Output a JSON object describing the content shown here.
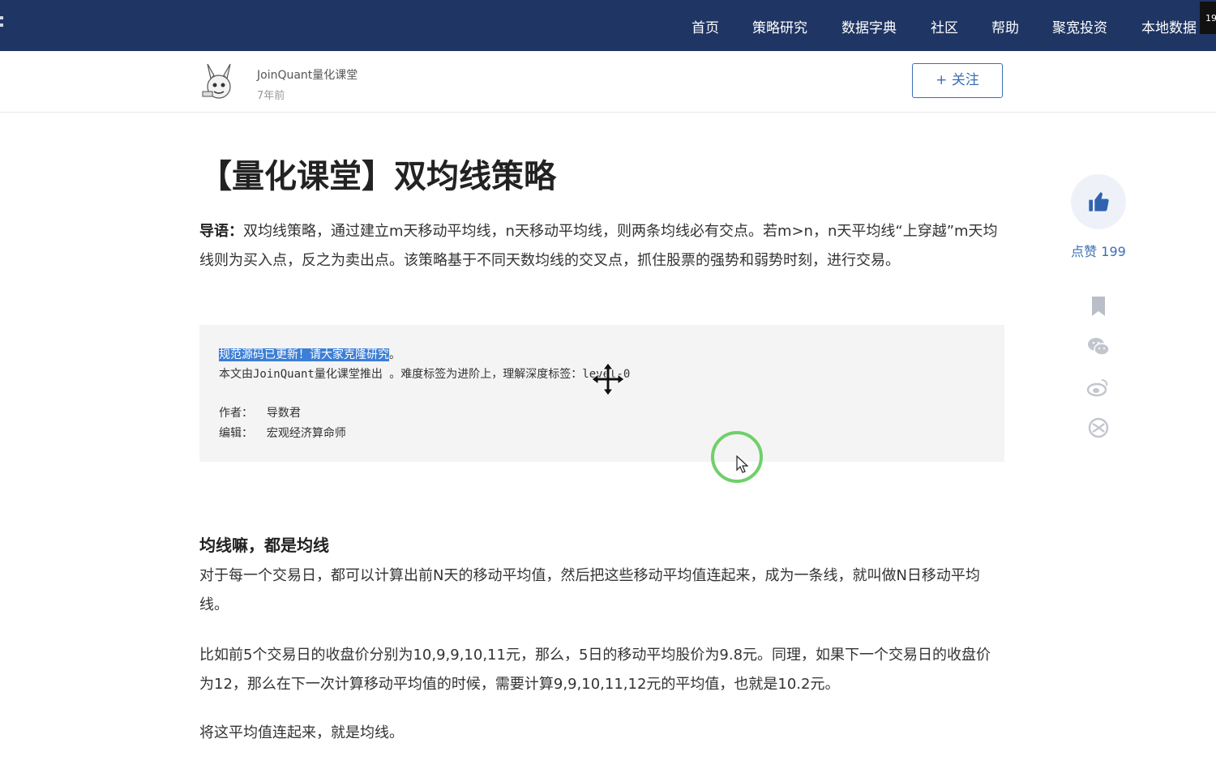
{
  "nav": {
    "items": [
      "首页",
      "策略研究",
      "数据字典",
      "社区",
      "帮助",
      "聚宽投资",
      "本地数据"
    ],
    "badge": "19"
  },
  "author": {
    "name": "JoinQuant量化课堂",
    "time": "7年前",
    "follow_label": "+ 关注"
  },
  "article": {
    "title": "【量化课堂】双均线策略",
    "intro_label": "导语：",
    "intro_text": "双均线策略，通过建立m天移动平均线，n天移动平均线，则两条均线必有交点。若m>n，n天平均线“上穿越”m天均线则为买入点，反之为卖出点。该策略基于不同天数均线的交叉点，抓住股票的强势和弱势时刻，进行交易。",
    "code": {
      "line1_highlight": "规范源码已更新！请大家克隆研究",
      "line1_rest": "。",
      "line2": "本文由JoinQuant量化课堂推出 。难度标签为进阶上，理解深度标签：level-0",
      "line3": "作者：  导数君",
      "line4": "编辑：  宏观经济算命师"
    },
    "section_title": "均线嘛，都是均线",
    "para1": "对于每一个交易日，都可以计算出前N天的移动平均值，然后把这些移动平均值连起来，成为一条线，就叫做N日移动平均线。",
    "para2": "比如前5个交易日的收盘价分别为10,9,9,10,11元，那么，5日的移动平均股价为9.8元。同理，如果下一个交易日的收盘价为12，那么在下一次计算移动平均值的时候，需要计算9,9,10,11,12元的平均值，也就是10.2元。",
    "para3": "将这平均值连起来，就是均线。"
  },
  "rail": {
    "like_label": "点赞 199",
    "icons": [
      "thumbs-up-icon",
      "bookmark-icon",
      "wechat-icon",
      "weibo-icon",
      "share-icon"
    ]
  },
  "colors": {
    "nav_bg": "#1f3563",
    "accent": "#3b6fb6",
    "highlight": "#3c7fd6",
    "click_ring": "#6fd06a"
  }
}
